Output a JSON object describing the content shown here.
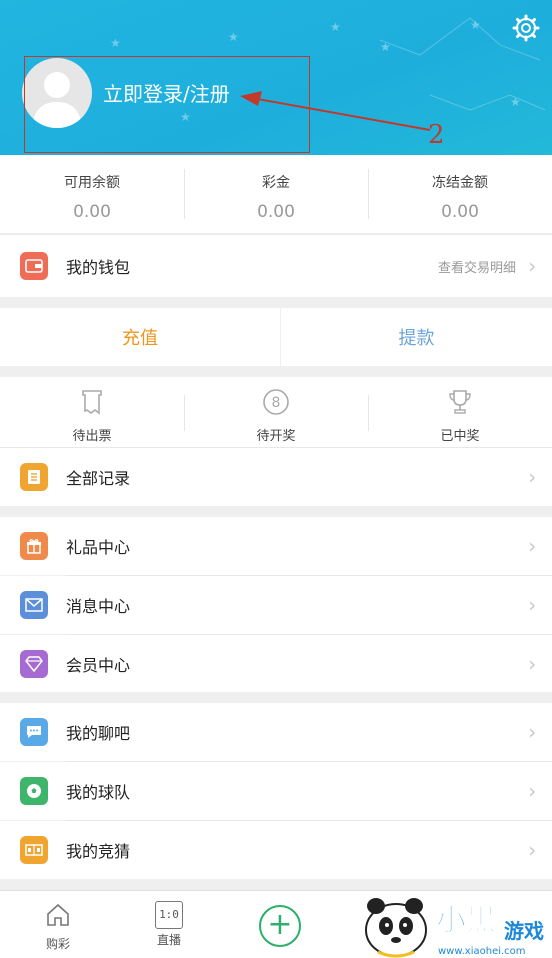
{
  "header": {
    "login_text": "立即登录/注册",
    "annotation_number": "2"
  },
  "balances": [
    {
      "label": "可用余额",
      "value": "0.00"
    },
    {
      "label": "彩金",
      "value": "0.00"
    },
    {
      "label": "冻结金额",
      "value": "0.00"
    }
  ],
  "wallet": {
    "label": "我的钱包",
    "link": "查看交易明细"
  },
  "actions": {
    "recharge": "充值",
    "withdraw": "提款"
  },
  "tickets": [
    {
      "label": "待出票",
      "icon": "ticket-icon"
    },
    {
      "label": "待开奖",
      "icon": "number-8-icon"
    },
    {
      "label": "已中奖",
      "icon": "trophy-icon"
    }
  ],
  "records": {
    "label": "全部记录"
  },
  "group1": [
    {
      "label": "礼品中心",
      "icon": "gift-icon",
      "color": "#f08a4b"
    },
    {
      "label": "消息中心",
      "icon": "envelope-icon",
      "color": "#5b8fd9"
    },
    {
      "label": "会员中心",
      "icon": "diamond-icon",
      "color": "#a66bd3"
    }
  ],
  "group2": [
    {
      "label": "我的聊吧",
      "icon": "chat-icon",
      "color": "#59a9e6"
    },
    {
      "label": "我的球队",
      "icon": "soccer-ball-icon",
      "color": "#3fb56b"
    },
    {
      "label": "我的竞猜",
      "icon": "scoreboard-icon",
      "color": "#f0a531"
    }
  ],
  "tabbar": {
    "home": "购彩",
    "live": "直播",
    "live_icon_text": "1:0"
  },
  "watermark": {
    "text": "小黑游戏",
    "url": "www.xiaohei.com"
  },
  "colors": {
    "header": "#1eaedc",
    "recharge": "#f0961e",
    "withdraw": "#6aa4d8",
    "accent_green": "#2bb06a"
  }
}
